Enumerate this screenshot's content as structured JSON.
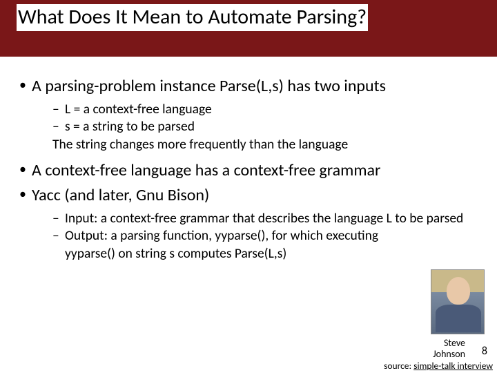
{
  "title": "What Does It Mean to Automate Parsing?",
  "bullets": {
    "b1": "A parsing-problem instance Parse(L,s) has two inputs",
    "sub1": {
      "a": "L = a context-free language",
      "b": "s = a string to be parsed",
      "note": "The string changes more frequently than the language"
    },
    "b2": "A context-free language has a context-free grammar",
    "b3": "Yacc (and later, Gnu Bison)",
    "sub2": {
      "a": "Input: a context-free grammar that describes the language L to be parsed",
      "b": "Output: a parsing function, yyparse(), for which executing yyparse() on string s computes Parse(L,s)"
    }
  },
  "caption": {
    "line1": "Steve",
    "line2": "Johnson"
  },
  "page_number": "8",
  "source": {
    "prefix": "source: ",
    "link": "simple-talk interview"
  }
}
